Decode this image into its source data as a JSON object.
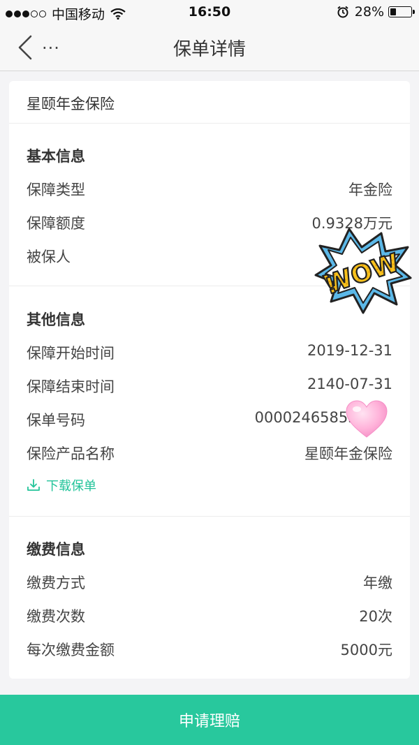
{
  "status_bar": {
    "carrier": "中国移动",
    "time": "16:50",
    "battery_percent": "28%",
    "battery_level": 0.28
  },
  "nav": {
    "title": "保单详情",
    "more_label": "...",
    "back_icon": "chevron-left-icon"
  },
  "product": {
    "name": "星颐年金保险"
  },
  "basic_info": {
    "title": "基本信息",
    "rows": [
      {
        "label": "保障类型",
        "value": "年金险"
      },
      {
        "label": "保障额度",
        "value": "0.9328万元"
      },
      {
        "label": "被保人",
        "value": ""
      }
    ]
  },
  "other_info": {
    "title": "其他信息",
    "rows": [
      {
        "label": "保障开始时间",
        "value": "2019-12-31"
      },
      {
        "label": "保障结束时间",
        "value": "2140-07-31"
      },
      {
        "label": "保单号码",
        "value": "000024658532"
      },
      {
        "label": "保险产品名称",
        "value": "星颐年金保险"
      }
    ],
    "download_label": "下载保单",
    "download_icon": "download-icon"
  },
  "payment_info": {
    "title": "缴费信息",
    "rows": [
      {
        "label": "缴费方式",
        "value": "年缴"
      },
      {
        "label": "缴费次数",
        "value": "20次"
      },
      {
        "label": "每次缴费金额",
        "value": "5000元"
      }
    ]
  },
  "stickers": {
    "wow_text": "WOW",
    "wow_icon": "wow-burst-sticker",
    "heart_icon": "pink-heart-sticker"
  },
  "footer": {
    "claim_label": "申请理赔"
  },
  "colors": {
    "accent": "#28c89d",
    "link": "#23c49a",
    "background": "#f4f4f6"
  }
}
